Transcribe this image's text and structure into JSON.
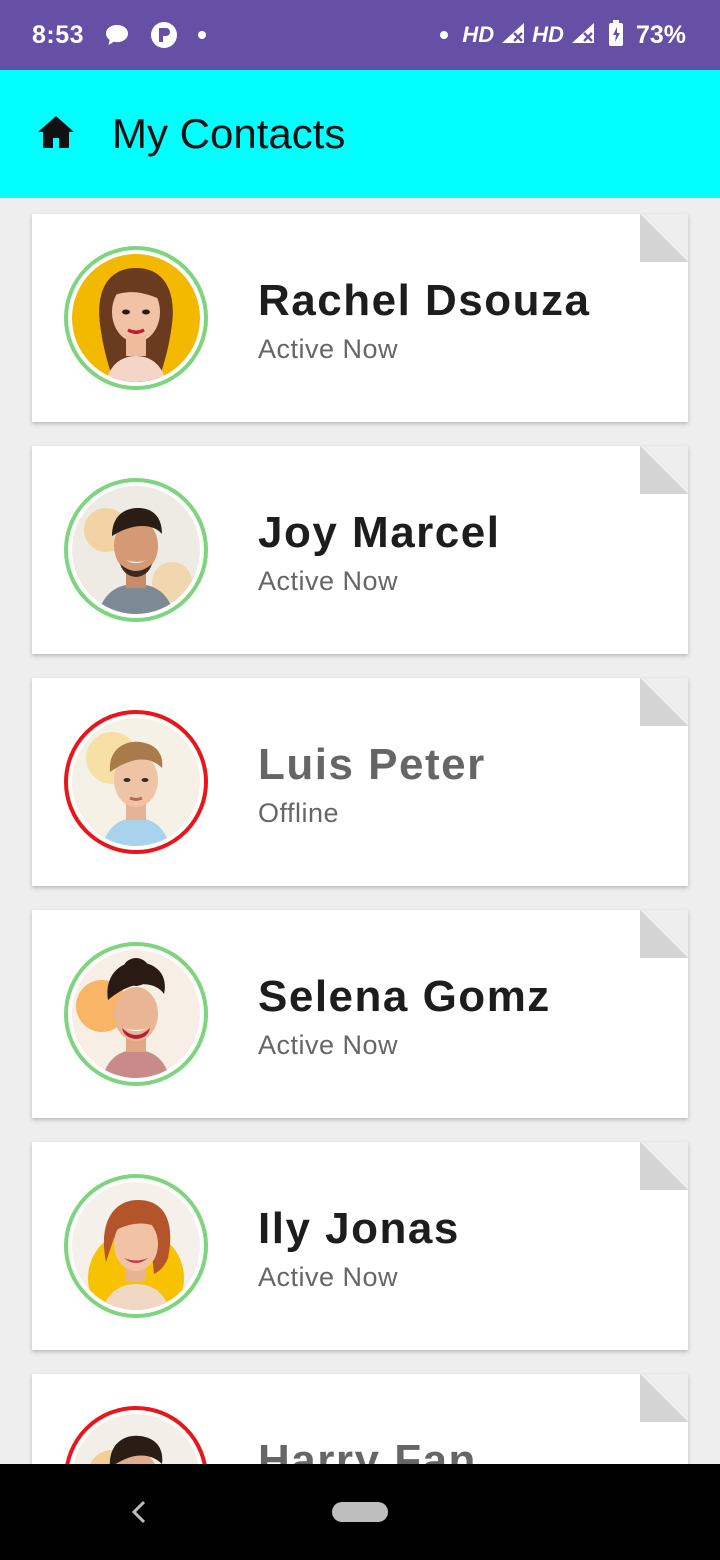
{
  "status_bar": {
    "time": "8:53",
    "network_1": "HD",
    "network_2": "HD",
    "battery": "73%"
  },
  "app_bar": {
    "title": "My Contacts",
    "icon": "home-icon"
  },
  "contacts": [
    {
      "name": "Rachel Dsouza",
      "status": "Active Now",
      "online": true
    },
    {
      "name": "Joy Marcel",
      "status": "Active Now",
      "online": true
    },
    {
      "name": "Luis Peter",
      "status": "Offline",
      "online": false
    },
    {
      "name": "Selena Gomz",
      "status": "Active Now",
      "online": true
    },
    {
      "name": "Ily Jonas",
      "status": "Active Now",
      "online": true
    },
    {
      "name": "Harry Fan",
      "status": "",
      "online": false
    }
  ],
  "colors": {
    "status_bar": "#6650a6",
    "app_bar": "#00ffff",
    "online_ring": "#7fd47f",
    "offline_ring": "#e8161a"
  }
}
